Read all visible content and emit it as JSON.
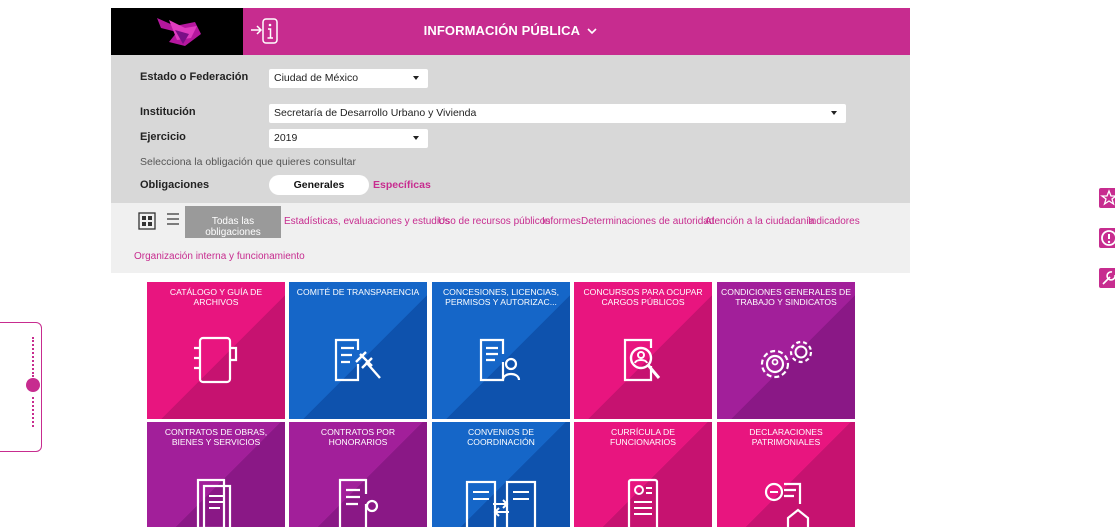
{
  "header": {
    "title": "INFORMACIÓN PÚBLICA",
    "chevron": "⌄"
  },
  "filters": {
    "estado_label": "Estado o Federación",
    "estado_value": "Ciudad de México",
    "institucion_label": "Institución",
    "institucion_value": "Secretaría de Desarrollo Urbano y Vivienda",
    "ejercicio_label": "Ejercicio",
    "ejercicio_value": "2019",
    "hint": "Selecciona la obligación que quieres consultar",
    "obligaciones_label": "Obligaciones",
    "generales": "Generales",
    "especificas": "Específicas"
  },
  "tabs": {
    "active": "Todas las obligaciones",
    "items": [
      "Estadísticas, evaluaciones y estudios",
      "Uso de recursos públicos",
      "Informes",
      "Determinaciones de autoridad",
      "Atención a la ciudadanía",
      "Indicadores",
      "Organización interna y funcionamiento"
    ]
  },
  "tiles": [
    {
      "title": "CATÁLOGO Y GUÍA DE ARCHIVOS",
      "color": "#e8157f",
      "icon": "binder-icon"
    },
    {
      "title": "COMITÉ DE TRANSPARENCIA",
      "color": "#1566c8",
      "icon": "gavel-document-icon"
    },
    {
      "title": "CONCESIONES, LICENCIAS, PERMISOS Y AUTORIZAC...",
      "color": "#1566c8",
      "icon": "document-person-icon"
    },
    {
      "title": "CONCURSOS PARA OCUPAR CARGOS PÚBLICOS",
      "color": "#e8157f",
      "icon": "search-person-icon"
    },
    {
      "title": "CONDICIONES GENERALES DE TRABAJO Y SINDICATOS",
      "color": "#a21f9a",
      "icon": "gears-icon"
    },
    {
      "title": "CONTRATOS DE OBRAS, BIENES Y SERVICIOS",
      "color": "#a21f9a",
      "icon": "documents-icon"
    },
    {
      "title": "CONTRATOS POR HONORARIOS",
      "color": "#a21f9a",
      "icon": "document-person-icon"
    },
    {
      "title": "CONVENIOS DE COORDINACIÓN",
      "color": "#1566c8",
      "icon": "exchange-documents-icon"
    },
    {
      "title": "CURRÍCULA DE FUNCIONARIOS",
      "color": "#e8157f",
      "icon": "resume-icon"
    },
    {
      "title": "DECLARACIONES PATRIMONIALES",
      "color": "#e8157f",
      "icon": "declaration-icon"
    }
  ]
}
